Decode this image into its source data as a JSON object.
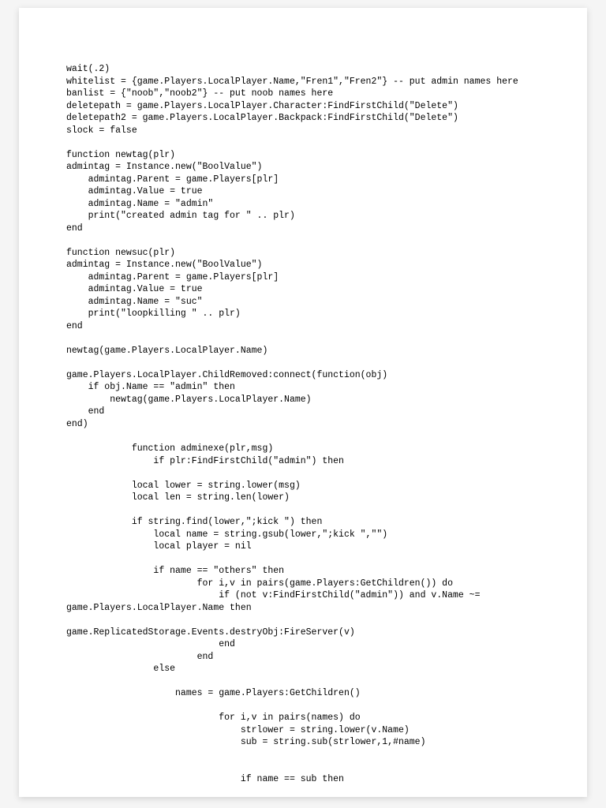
{
  "code": {
    "lines": [
      "wait(.2)",
      "whitelist = {game.Players.LocalPlayer.Name,\"Fren1\",\"Fren2\"} -- put admin names here",
      "banlist = {\"noob\",\"noob2\"} -- put noob names here",
      "deletepath = game.Players.LocalPlayer.Character:FindFirstChild(\"Delete\")",
      "deletepath2 = game.Players.LocalPlayer.Backpack:FindFirstChild(\"Delete\")",
      "slock = false",
      "",
      "function newtag(plr)",
      "admintag = Instance.new(\"BoolValue\")",
      "    admintag.Parent = game.Players[plr]",
      "    admintag.Value = true",
      "    admintag.Name = \"admin\"",
      "    print(\"created admin tag for \" .. plr)",
      "end",
      "",
      "function newsuc(plr)",
      "admintag = Instance.new(\"BoolValue\")",
      "    admintag.Parent = game.Players[plr]",
      "    admintag.Value = true",
      "    admintag.Name = \"suc\"",
      "    print(\"loopkilling \" .. plr)",
      "end",
      "",
      "newtag(game.Players.LocalPlayer.Name)",
      "",
      "game.Players.LocalPlayer.ChildRemoved:connect(function(obj)",
      "    if obj.Name == \"admin\" then",
      "        newtag(game.Players.LocalPlayer.Name)",
      "    end",
      "end)",
      "    ",
      "            function adminexe(plr,msg)",
      "                if plr:FindFirstChild(\"admin\") then",
      "            ",
      "            local lower = string.lower(msg)",
      "            local len = string.len(lower)",
      "            ",
      "            if string.find(lower,\";kick \") then",
      "                local name = string.gsub(lower,\";kick \",\"\")",
      "                local player = nil",
      "                ",
      "                if name == \"others\" then",
      "                        for i,v in pairs(game.Players:GetChildren()) do",
      "                            if (not v:FindFirstChild(\"admin\")) and v.Name ~=",
      "game.Players.LocalPlayer.Name then",
      "                                ",
      "game.ReplicatedStorage.Events.destryObj:FireServer(v)",
      "                            end",
      "                        end",
      "                else",
      "                    ",
      "                    names = game.Players:GetChildren()",
      "                                ",
      "                            for i,v in pairs(names) do",
      "                                strlower = string.lower(v.Name)",
      "                                sub = string.sub(strlower,1,#name)",
      "                                ",
      "                                ",
      "                                if name == sub then"
    ]
  }
}
